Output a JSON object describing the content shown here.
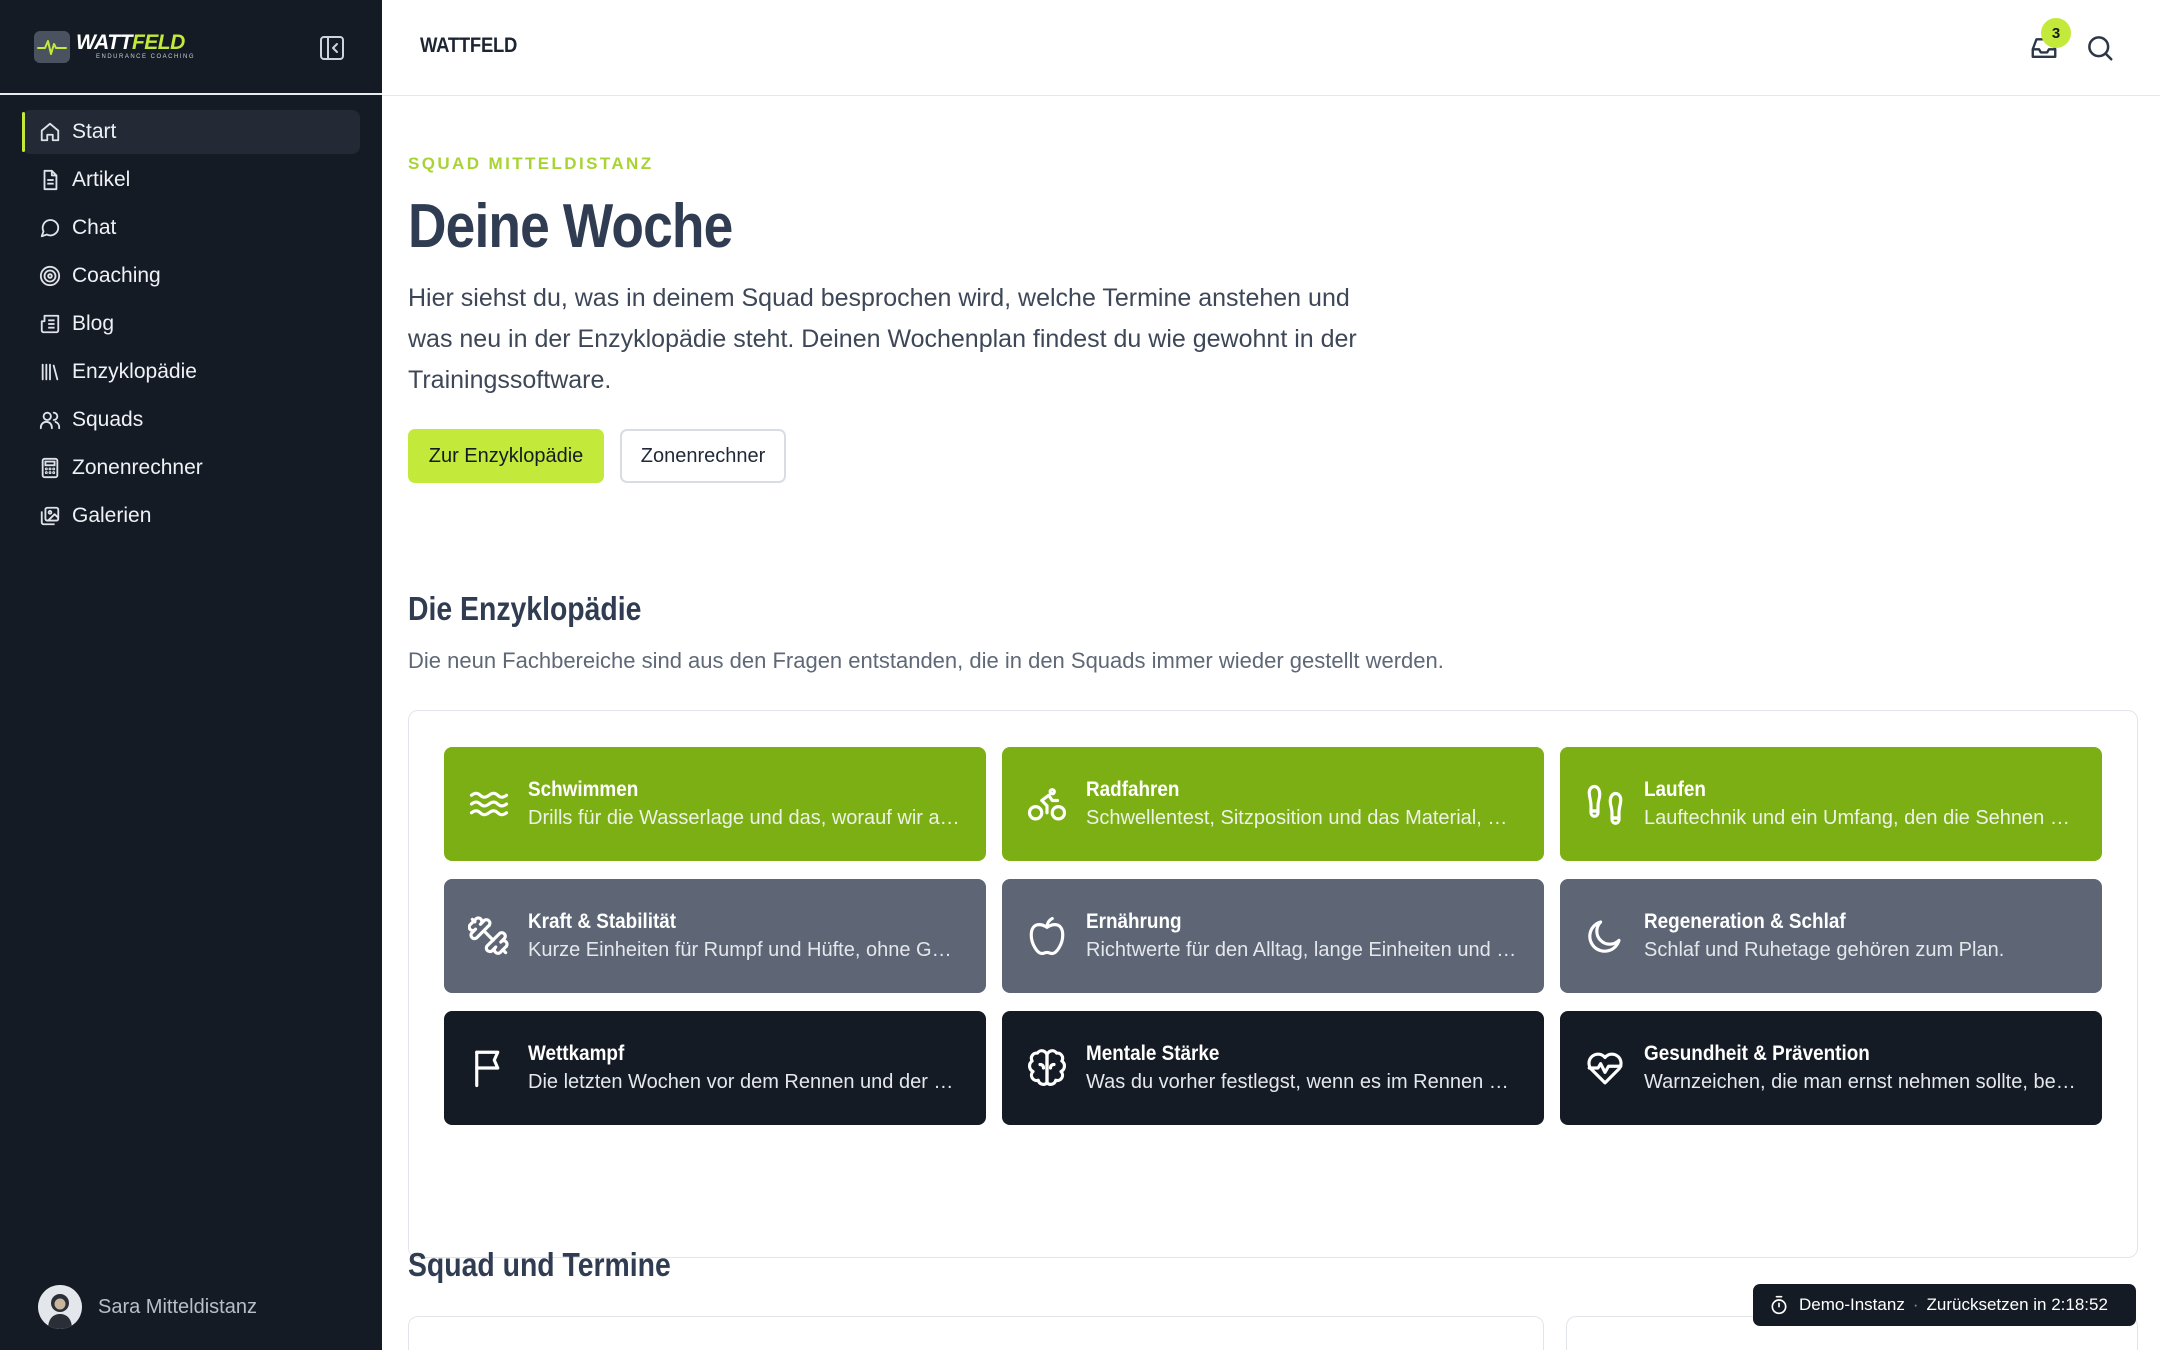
{
  "brand": {
    "name_a": "WATT",
    "name_b": "FELD",
    "tagline": "ENDURANCE COACHING",
    "accent": "#c3ea3a"
  },
  "header": {
    "title": "WATTFELD",
    "inbox_count": "3"
  },
  "sidebar": {
    "items": [
      {
        "label": "Start",
        "icon": "home-icon"
      },
      {
        "label": "Artikel",
        "icon": "document-icon"
      },
      {
        "label": "Chat",
        "icon": "chat-bubble-icon"
      },
      {
        "label": "Coaching",
        "icon": "target-icon"
      },
      {
        "label": "Blog",
        "icon": "newspaper-icon"
      },
      {
        "label": "Enzyklopädie",
        "icon": "library-icon"
      },
      {
        "label": "Squads",
        "icon": "users-icon"
      },
      {
        "label": "Zonenrechner",
        "icon": "calculator-icon"
      },
      {
        "label": "Galerien",
        "icon": "gallery-icon"
      }
    ],
    "user": {
      "name": "Sara Mitteldistanz"
    }
  },
  "main": {
    "eyebrow": "SQUAD MITTELDISTANZ",
    "title": "Deine Woche",
    "intro": "Hier siehst du, was in deinem Squad besprochen wird, welche Termine anstehen und was neu in der Enzyklopädie steht. Deinen Wochenplan findest du wie gewohnt in der Trainingssoftware.",
    "primary_button": "Zur Enzyklopädie",
    "secondary_button": "Zonenrechner",
    "encyclopedia": {
      "title": "Die Enzyklopädie",
      "subtitle": "Die neun Fachbereiche sind aus den Fragen entstanden, die in den Squads immer wieder gestellt werden.",
      "tiles": [
        {
          "title": "Schwimmen",
          "desc": "Drills für die Wasserlage und das, worauf wir achten",
          "icon": "waves-icon",
          "tone": "green"
        },
        {
          "title": "Radfahren",
          "desc": "Schwellentest, Sitzposition und das Material, das zählt",
          "icon": "bicycle-icon",
          "tone": "green"
        },
        {
          "title": "Laufen",
          "desc": "Lauftechnik und ein Umfang, den die Sehnen mitmachen",
          "icon": "footprints-icon",
          "tone": "green"
        },
        {
          "title": "Kraft & Stabilität",
          "desc": "Kurze Einheiten für Rumpf und Hüfte, ohne Geräte",
          "icon": "dumbbell-icon",
          "tone": "gray"
        },
        {
          "title": "Ernährung",
          "desc": "Richtwerte für den Alltag, lange Einheiten und Rennen",
          "icon": "apple-icon",
          "tone": "gray"
        },
        {
          "title": "Regeneration & Schlaf",
          "desc": "Schlaf und Ruhetage gehören zum Plan.",
          "icon": "moon-icon",
          "tone": "gray"
        },
        {
          "title": "Wettkampf",
          "desc": "Die letzten Wochen vor dem Rennen und der Renntag",
          "icon": "flag-icon",
          "tone": "dark"
        },
        {
          "title": "Mentale Stärke",
          "desc": "Was du vorher festlegst, wenn es im Rennen schwer wird",
          "icon": "brain-icon",
          "tone": "dark"
        },
        {
          "title": "Gesundheit & Prävention",
          "desc": "Warnzeichen, die man ernst nehmen sollte, bevor es weh tut",
          "icon": "heart-pulse-icon",
          "tone": "dark"
        }
      ]
    },
    "squad_section": {
      "title": "Squad und Termine"
    }
  },
  "toast": {
    "label": "Demo-Instanz",
    "separator": "·",
    "reset": "Zurücksetzen in 2:18:52"
  }
}
